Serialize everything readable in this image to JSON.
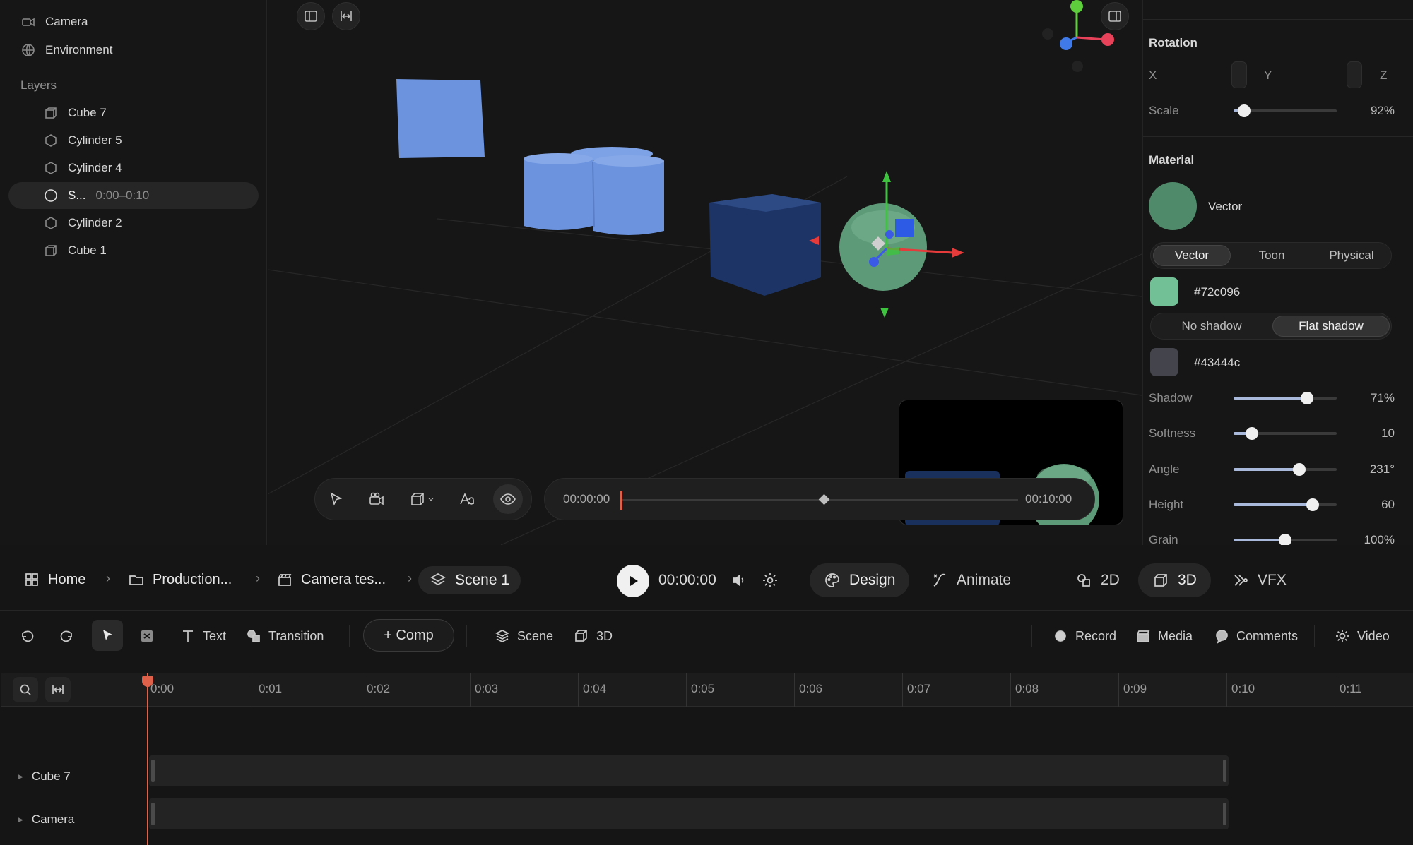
{
  "scene_tree": {
    "items": [
      {
        "label": "Camera",
        "icon": "camera-icon"
      },
      {
        "label": "Environment",
        "icon": "globe-icon"
      }
    ],
    "layers_heading": "Layers",
    "layers": [
      {
        "label": "Cube 7",
        "icon": "cube-icon"
      },
      {
        "label": "Cylinder 5",
        "icon": "cylinder-icon"
      },
      {
        "label": "Cylinder 4",
        "icon": "cylinder-icon"
      },
      {
        "label": "S...",
        "sub": "0:00–0:10",
        "icon": "sphere-icon",
        "selected": true
      },
      {
        "label": "Cylinder 2",
        "icon": "cylinder-icon"
      },
      {
        "label": "Cube 1",
        "icon": "cube-icon"
      }
    ]
  },
  "viewport": {
    "scrubber": {
      "start": "00:00:00",
      "end": "00:10:00"
    }
  },
  "inspector": {
    "rotation": {
      "title": "Rotation",
      "x_label": "X",
      "y_label": "Y",
      "z_label": "Z"
    },
    "scale": {
      "label": "Scale",
      "value": "92%",
      "level": 0.1
    },
    "material": {
      "title": "Material",
      "preview_label": "Vector",
      "types": [
        "Vector",
        "Toon",
        "Physical"
      ],
      "active_type": "Vector",
      "color": "#72c096",
      "shadow_modes": [
        "No shadow",
        "Flat shadow"
      ],
      "active_shadow": "Flat shadow",
      "shadow_color": "#43444c"
    },
    "sliders": [
      {
        "label": "Shadow",
        "value": "71%",
        "level": 0.71
      },
      {
        "label": "Softness",
        "value": "10",
        "level": 0.18
      },
      {
        "label": "Angle",
        "value": "231°",
        "level": 0.64
      },
      {
        "label": "Height",
        "value": "60",
        "level": 0.77
      },
      {
        "label": "Grain",
        "value": "100%",
        "level": 0.5
      }
    ]
  },
  "navbar": {
    "breadcrumbs": [
      "Home",
      "Production...",
      "Camera tes...",
      "Scene 1"
    ],
    "time": "00:00:00",
    "modes": [
      "Design",
      "Animate"
    ],
    "active_mode": "Design",
    "dims": [
      "2D",
      "3D",
      "VFX"
    ],
    "active_dim": "3D"
  },
  "toolbar": {
    "text": "Text",
    "transition": "Transition",
    "comp": "+ Comp",
    "scene": "Scene",
    "three_d": "3D",
    "record": "Record",
    "media": "Media",
    "comments": "Comments",
    "video": "Video"
  },
  "timeline": {
    "ticks": [
      "0:00",
      "0:01",
      "0:02",
      "0:03",
      "0:04",
      "0:05",
      "0:06",
      "0:07",
      "0:08",
      "0:09",
      "0:10",
      "0:11"
    ],
    "tracks": [
      "Cube 7",
      "Camera"
    ]
  },
  "colors": {
    "accent_playhead": "#e0614a",
    "object_blue": "#6b93de",
    "cube_navy": "#1c3466",
    "sphere_green": "#5d9a78"
  }
}
